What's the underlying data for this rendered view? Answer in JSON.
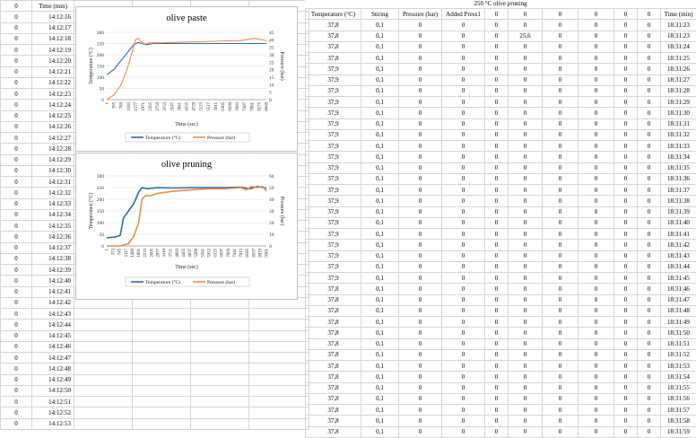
{
  "sheet": {
    "left_headers": [
      "0",
      "Time (min)"
    ],
    "left_rows": [
      [
        "0",
        "14:12:16"
      ],
      [
        "0",
        "14:12:17"
      ],
      [
        "0",
        "14:12:18"
      ],
      [
        "0",
        "14:12:19"
      ],
      [
        "0",
        "14:12:20"
      ],
      [
        "0",
        "14:12:21"
      ],
      [
        "0",
        "14:12:22"
      ],
      [
        "0",
        "14:12:23"
      ],
      [
        "0",
        "14:12:24"
      ],
      [
        "0",
        "14:12:25"
      ],
      [
        "0",
        "14:12:26"
      ],
      [
        "0",
        "14:12:27"
      ],
      [
        "0",
        "14:12:28"
      ],
      [
        "0",
        "14:12:29"
      ],
      [
        "0",
        "14:12:30"
      ],
      [
        "0",
        "14:12:31"
      ],
      [
        "0",
        "14:12:32"
      ],
      [
        "0",
        "14:12:33"
      ],
      [
        "0",
        "14:12:34"
      ],
      [
        "0",
        "14:12:35"
      ],
      [
        "0",
        "14:12:36"
      ],
      [
        "0",
        "14:12:37"
      ],
      [
        "0",
        "14:12:38"
      ],
      [
        "0",
        "14:12:39"
      ],
      [
        "0",
        "14:12:40"
      ],
      [
        "0",
        "14:12:41"
      ],
      [
        "0",
        "14:12:42"
      ],
      [
        "0",
        "14:12:43"
      ],
      [
        "0",
        "14:12:44"
      ],
      [
        "0",
        "14:12:45"
      ],
      [
        "0",
        "14:12:46"
      ],
      [
        "0",
        "14:12:47"
      ],
      [
        "0",
        "14:12:48"
      ],
      [
        "0",
        "14:12:49"
      ],
      [
        "0",
        "14:12:50"
      ],
      [
        "0",
        "14:12:51"
      ],
      [
        "0",
        "14:12:52"
      ],
      [
        "0",
        "14:12:53"
      ]
    ],
    "right_title": "250 °C olive pruning",
    "right_headers": [
      "Temperature (°C)",
      "Stiring",
      "Pressure (bar)",
      "Added Press1",
      "0",
      "0",
      "0",
      "0",
      "0",
      "0",
      "Time (min)"
    ],
    "right_rows": [
      [
        "37,8",
        "0,1",
        "0",
        "0",
        "0",
        "0",
        "0",
        "0",
        "0",
        "0",
        "18:31:23"
      ],
      [
        "37,8",
        "0,1",
        "0",
        "0",
        "0",
        "25,6",
        "0",
        "0",
        "0",
        "0",
        "18:31:23"
      ],
      [
        "37,8",
        "0,1",
        "0",
        "0",
        "0",
        "0",
        "0",
        "0",
        "0",
        "0",
        "18:31:24"
      ],
      [
        "37,8",
        "0,1",
        "0",
        "0",
        "0",
        "0",
        "0",
        "0",
        "0",
        "0",
        "18:31:25"
      ],
      [
        "37,9",
        "0,1",
        "0",
        "0",
        "0",
        "0",
        "0",
        "0",
        "0",
        "0",
        "18:31:26"
      ],
      [
        "37,9",
        "0,1",
        "0",
        "0",
        "0",
        "0",
        "0",
        "0",
        "0",
        "0",
        "18:31:27"
      ],
      [
        "37,9",
        "0,1",
        "0",
        "0",
        "0",
        "0",
        "0",
        "0",
        "0",
        "0",
        "18:31:28"
      ],
      [
        "37,9",
        "0,1",
        "0",
        "0",
        "0",
        "0",
        "0",
        "0",
        "0",
        "0",
        "18:31:29"
      ],
      [
        "37,9",
        "0,1",
        "0",
        "0",
        "0",
        "0",
        "0",
        "0",
        "0",
        "0",
        "18:31:30"
      ],
      [
        "37,9",
        "0,1",
        "0",
        "0",
        "0",
        "0",
        "0",
        "0",
        "0",
        "0",
        "18:31:31"
      ],
      [
        "37,9",
        "0,1",
        "0",
        "0",
        "0",
        "0",
        "0",
        "0",
        "0",
        "0",
        "18:31:32"
      ],
      [
        "37,9",
        "0,1",
        "0",
        "0",
        "0",
        "0",
        "0",
        "0",
        "0",
        "0",
        "18:31:33"
      ],
      [
        "37,9",
        "0,1",
        "0",
        "0",
        "0",
        "0",
        "0",
        "0",
        "0",
        "0",
        "18:31:34"
      ],
      [
        "37,9",
        "0,1",
        "0",
        "0",
        "0",
        "0",
        "0",
        "0",
        "0",
        "0",
        "18:31:35"
      ],
      [
        "37,9",
        "0,1",
        "0",
        "0",
        "0",
        "0",
        "0",
        "0",
        "0",
        "0",
        "18:31:36"
      ],
      [
        "37,9",
        "0,1",
        "0",
        "0",
        "0",
        "0",
        "0",
        "0",
        "0",
        "0",
        "18:31:37"
      ],
      [
        "37,9",
        "0,1",
        "0",
        "0",
        "0",
        "0",
        "0",
        "0",
        "0",
        "0",
        "18:31:38"
      ],
      [
        "37,9",
        "0,1",
        "0",
        "0",
        "0",
        "0",
        "0",
        "0",
        "0",
        "0",
        "18:31:39"
      ],
      [
        "37,9",
        "0,1",
        "0",
        "0",
        "0",
        "0",
        "0",
        "0",
        "0",
        "0",
        "18:31:40"
      ],
      [
        "37,9",
        "0,1",
        "0",
        "0",
        "0",
        "0",
        "0",
        "0",
        "0",
        "0",
        "18:31:41"
      ],
      [
        "37,9",
        "0,1",
        "0",
        "0",
        "0",
        "0",
        "0",
        "0",
        "0",
        "0",
        "18:31:42"
      ],
      [
        "37,9",
        "0,1",
        "0",
        "0",
        "0",
        "0",
        "0",
        "0",
        "0",
        "0",
        "18:31:43"
      ],
      [
        "37,9",
        "0,1",
        "0",
        "0",
        "0",
        "0",
        "0",
        "0",
        "0",
        "0",
        "18:31:44"
      ],
      [
        "37,9",
        "0,1",
        "0",
        "0",
        "0",
        "0",
        "0",
        "0",
        "0",
        "0",
        "18:31:45"
      ],
      [
        "37,8",
        "0,1",
        "0",
        "0",
        "0",
        "0",
        "0",
        "0",
        "0",
        "0",
        "18:31:46"
      ],
      [
        "37,8",
        "0,1",
        "0",
        "0",
        "0",
        "0",
        "0",
        "0",
        "0",
        "0",
        "18:31:47"
      ],
      [
        "37,8",
        "0,1",
        "0",
        "0",
        "0",
        "0",
        "0",
        "0",
        "0",
        "0",
        "18:31:48"
      ],
      [
        "37,8",
        "0,1",
        "0",
        "0",
        "0",
        "0",
        "0",
        "0",
        "0",
        "0",
        "18:31:49"
      ],
      [
        "37,8",
        "0,1",
        "0",
        "0",
        "0",
        "0",
        "0",
        "0",
        "0",
        "0",
        "18:31:50"
      ],
      [
        "37,8",
        "0,1",
        "0",
        "0",
        "0",
        "0",
        "0",
        "0",
        "0",
        "0",
        "18:31:51"
      ],
      [
        "37,8",
        "0,1",
        "0",
        "0",
        "0",
        "0",
        "0",
        "0",
        "0",
        "0",
        "18:31:52"
      ],
      [
        "37,8",
        "0,1",
        "0",
        "0",
        "0",
        "0",
        "0",
        "0",
        "0",
        "0",
        "18:31:53"
      ],
      [
        "37,8",
        "0,1",
        "0",
        "0",
        "0",
        "0",
        "0",
        "0",
        "0",
        "0",
        "18:31:54"
      ],
      [
        "37,8",
        "0,1",
        "0",
        "0",
        "0",
        "0",
        "0",
        "0",
        "0",
        "0",
        "18:31:55"
      ],
      [
        "37,8",
        "0,1",
        "0",
        "0",
        "0",
        "0",
        "0",
        "0",
        "0",
        "0",
        "18:31:56"
      ],
      [
        "37,8",
        "0,1",
        "0",
        "0",
        "0",
        "0",
        "0",
        "0",
        "0",
        "0",
        "18:31:57"
      ],
      [
        "37,8",
        "0,1",
        "0",
        "0",
        "0",
        "0",
        "0",
        "0",
        "0",
        "0",
        "18:31:58"
      ],
      [
        "37,8",
        "0,1",
        "0",
        "0",
        "0",
        "0",
        "0",
        "0",
        "0",
        "0",
        "18:31:59"
      ]
    ]
  },
  "colors": {
    "temperature": "#2e6aa3",
    "pressure": "#f08a4b",
    "gridline": "#d9d9d9"
  },
  "chart_data": [
    {
      "type": "line",
      "title": "olive paste",
      "xlabel": "Time (sec)",
      "ylabel": "Temperature (°C)",
      "y2label": "Pressure (bar)",
      "x_tick_labels": [
        "1",
        "395",
        "789",
        "1183",
        "1577",
        "1971",
        "2365",
        "2759",
        "3153",
        "3547",
        "3941",
        "4335",
        "4729",
        "5123",
        "5517",
        "5911",
        "6305",
        "6699",
        "7093",
        "7487",
        "7881",
        "8275",
        "8669"
      ],
      "ylim": [
        0,
        300
      ],
      "y_ticks": [
        "0",
        "50",
        "100",
        "150",
        "200",
        "250",
        "300"
      ],
      "y2lim": [
        0,
        45
      ],
      "y2_ticks": [
        "0",
        "5",
        "10",
        "15",
        "20",
        "25",
        "30",
        "35",
        "40",
        "45"
      ],
      "xlim": [
        1,
        8900
      ],
      "legend_position": "bottom",
      "series": [
        {
          "name": "Temperature (°C)",
          "axis": "left",
          "x": [
            1,
            400,
            800,
            1200,
            1500,
            1750,
            1950,
            2200,
            2600,
            3500,
            5000,
            7000,
            8900
          ],
          "values": [
            110,
            135,
            175,
            215,
            245,
            255,
            250,
            245,
            250,
            250,
            250,
            250,
            250
          ]
        },
        {
          "name": "Pressure (bar)",
          "axis": "right",
          "x": [
            1,
            400,
            800,
            1100,
            1400,
            1600,
            1750,
            1900,
            2100,
            2400,
            3000,
            4500,
            6000,
            7500,
            8200,
            8900
          ],
          "values": [
            0,
            3,
            10,
            19,
            31,
            40,
            41,
            39,
            37,
            38,
            38,
            38.5,
            39,
            39.5,
            41,
            39.5
          ]
        }
      ]
    },
    {
      "type": "line",
      "title": "olive pruning",
      "xlabel": "Time (sec)",
      "ylabel": "Temperature (°C)",
      "y2label": "Pressure (bar)",
      "x_tick_labels": [
        "1",
        "373",
        "745",
        "1117",
        "1489",
        "1861",
        "2233",
        "2605",
        "2977",
        "3349",
        "3721",
        "4093",
        "4465",
        "4837",
        "5209",
        "5581",
        "5953",
        "6325",
        "6697",
        "7069",
        "7441",
        "7813",
        "8185",
        "8557",
        "8929",
        "9301"
      ],
      "ylim": [
        0,
        300
      ],
      "y_ticks": [
        "0",
        "50",
        "100",
        "150",
        "200",
        "250",
        "300"
      ],
      "y2lim": [
        0,
        60
      ],
      "y2_ticks": [
        "0",
        "10",
        "20",
        "30",
        "40",
        "50",
        "60"
      ],
      "xlim": [
        1,
        9500
      ],
      "legend_position": "bottom",
      "series": [
        {
          "name": "Temperature (°C)",
          "axis": "left",
          "x": [
            1,
            500,
            800,
            1000,
            1300,
            1600,
            1900,
            2100,
            2400,
            3000,
            4000,
            5000,
            6000,
            7000,
            8000,
            8500,
            9000,
            9300,
            9500
          ],
          "values": [
            35,
            38,
            45,
            120,
            150,
            180,
            230,
            250,
            245,
            250,
            248,
            250,
            250,
            250,
            252,
            245,
            255,
            250,
            248
          ]
        },
        {
          "name": "Pressure (bar)",
          "axis": "right",
          "x": [
            1,
            800,
            1300,
            1600,
            1900,
            2100,
            2300,
            2600,
            3000,
            4000,
            5000,
            6000,
            7000,
            7500,
            8000,
            8300,
            8600,
            8900,
            9300,
            9500
          ],
          "values": [
            0,
            0,
            2,
            8,
            20,
            40,
            43,
            43,
            45,
            47,
            48,
            49,
            49,
            49.5,
            50,
            48,
            51,
            50,
            51,
            47
          ]
        }
      ]
    }
  ]
}
